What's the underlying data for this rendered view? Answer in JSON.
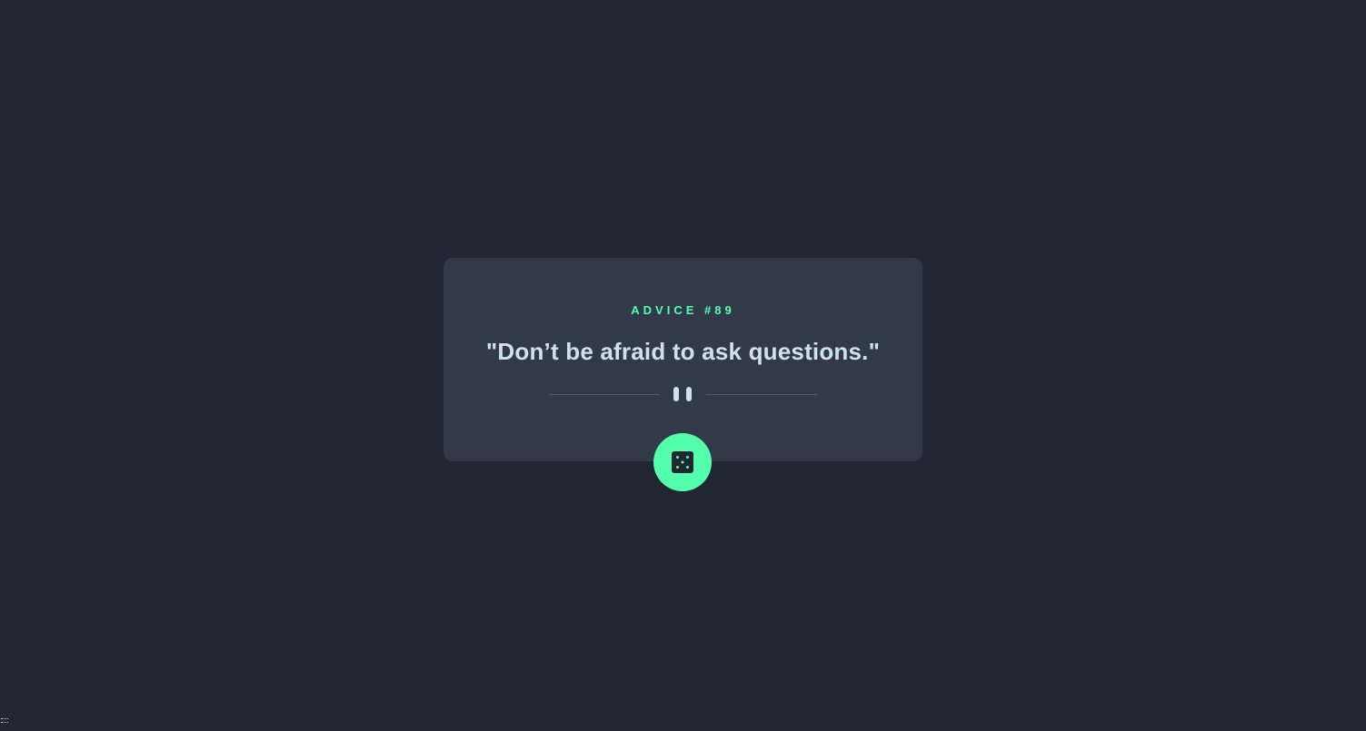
{
  "card": {
    "label": "ADVICE #89",
    "quote": "\"Don’t be afraid to ask questions.\""
  },
  "divider": {
    "icon": "pause-icon"
  },
  "button": {
    "icon": "dice-icon"
  },
  "colors": {
    "background": "#202632",
    "card": "#323A49",
    "accent": "#53FFAA",
    "text": "#CEE3E9",
    "divider": "#4F5D74"
  }
}
